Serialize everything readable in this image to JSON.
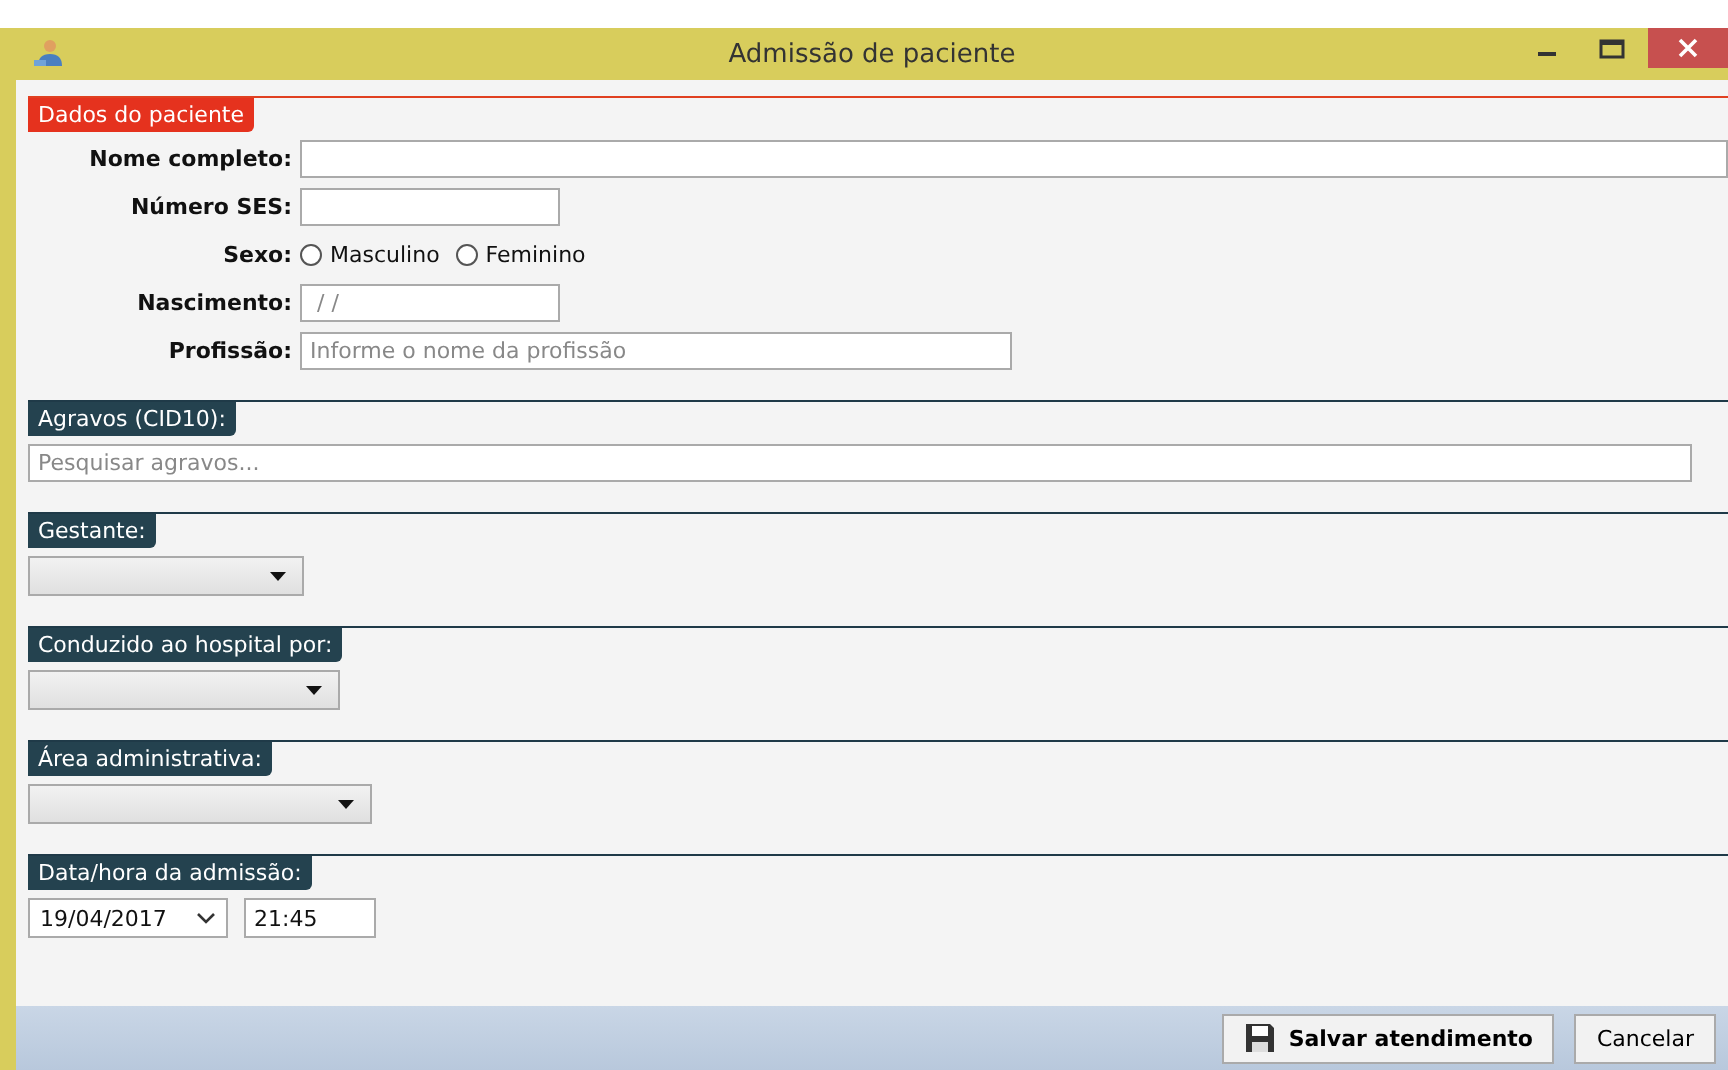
{
  "window": {
    "title": "Admissão de paciente"
  },
  "patient": {
    "heading": "Dados do paciente",
    "fields": [
      {
        "kind": "text",
        "label": "Nome completo:"
      },
      {
        "kind": "text",
        "label": "Número SES:"
      },
      {
        "kind": "radio",
        "label": "Sexo:",
        "options": [
          {
            "label": "Masculino",
            "selected": false
          },
          {
            "label": "Feminino",
            "selected": false
          }
        ]
      },
      {
        "kind": "text",
        "label": "Nascimento:",
        "placeholder": " / /"
      },
      {
        "kind": "text",
        "label": "Profissão:",
        "placeholder": "Informe o nome da profissão"
      }
    ]
  },
  "sections": [
    {
      "kind": "search",
      "heading": "Agravos (CID10):",
      "placeholder": "Pesquisar agravos..."
    },
    {
      "kind": "select",
      "heading": "Gestante:"
    },
    {
      "kind": "select",
      "heading": "Conduzido ao hospital por:"
    },
    {
      "kind": "select",
      "heading": "Área administrativa:"
    },
    {
      "kind": "datetime",
      "heading": "Data/hora da admissão:",
      "date": "19/04/2017",
      "time": "21:45"
    }
  ],
  "buttons": [
    {
      "kind": "save",
      "label": "Salvar atendimento"
    },
    {
      "kind": "cancel",
      "label": "Cancelar"
    }
  ]
}
